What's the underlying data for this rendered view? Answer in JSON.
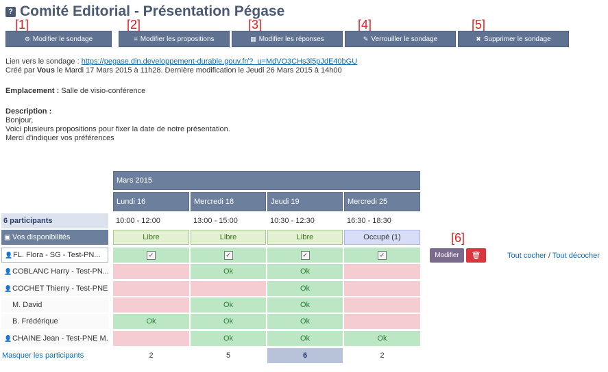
{
  "title": "Comité Editorial - Présentation Pégase",
  "title_icon": "question-icon",
  "markers": [
    "[1]",
    "[2]",
    "[3]",
    "[4]",
    "[5]",
    "[6]"
  ],
  "buttons": {
    "edit_poll": "Modifier le sondage",
    "edit_proposals": "Modifier les propositions",
    "edit_answers": "Modifier les réponses",
    "lock_poll": "Verrouiller le sondage",
    "delete_poll": "Supprimer le sondage"
  },
  "info": {
    "link_label": "Lien vers le sondage :",
    "link_url": "https://pegase.din.developpement-durable.gouv.fr/?_u=MdVO3CHs3l5pJdE40bGU",
    "created_prefix": "Créé par",
    "created_by": "Vous",
    "created_suffix": "le Mardi 17 Mars 2015 à 11h28. Dernière modification le Jeudi 26 Mars 2015 à 14h00",
    "location_label": "Emplacement :",
    "location_value": "Salle de visio-conférence",
    "description_label": "Description :",
    "description_lines": [
      "Bonjour,",
      "Voici plusieurs propositions pour fixer la date de notre présentation.",
      "Merci d'indiquer vos préférences"
    ]
  },
  "grid": {
    "month": "Mars 2015",
    "days": [
      "Lundi 16",
      "Mercredi 18",
      "Jeudi 19",
      "Mercredi 25"
    ],
    "times": [
      "10:00 - 12:00",
      "13:00 - 15:00",
      "10:30 - 12:30",
      "16:30 - 18:30"
    ],
    "participants_count": "6 participants",
    "availability_label": "Vos disponibilités",
    "availability": [
      "Libre",
      "Libre",
      "Libre",
      "Occupé (1)"
    ],
    "participants": [
      {
        "name": "FL. Flora - SG - Test-PN...",
        "icon": "person-icon",
        "cells": [
          "check",
          "check",
          "check",
          "check"
        ]
      },
      {
        "name": "COBLANC Harry - Test-PN...",
        "icon": "person-icon",
        "cells": [
          "",
          "Ok",
          "Ok",
          ""
        ]
      },
      {
        "name": "COCHET Thierry - Test-PNE...",
        "icon": "person-icon",
        "cells": [
          "",
          "",
          "Ok",
          ""
        ]
      },
      {
        "name": "M. David",
        "icon": "",
        "cells": [
          "",
          "Ok",
          "Ok",
          ""
        ]
      },
      {
        "name": "B. Frédérique",
        "icon": "",
        "cells": [
          "Ok",
          "Ok",
          "Ok",
          ""
        ]
      },
      {
        "name": "CHAINE Jean - Test-PNE M...",
        "icon": "person-icon",
        "cells": [
          "",
          "Ok",
          "Ok",
          "Ok"
        ]
      }
    ],
    "totals": [
      "2",
      "5",
      "6",
      "2"
    ],
    "hide_participants": "Masquer les participants"
  },
  "row_actions": {
    "modify": "Modifier",
    "delete_icon": "trash-icon",
    "check_all": "Tout cocher",
    "separator": "/",
    "uncheck_all": "Tout décocher"
  },
  "colors": {
    "ok": "#bde6c5",
    "not_ok": "#f5ccd2",
    "header": "#6c7f9c",
    "button": "#5f7291",
    "delete": "#d9363e",
    "marker": "#e02020"
  }
}
